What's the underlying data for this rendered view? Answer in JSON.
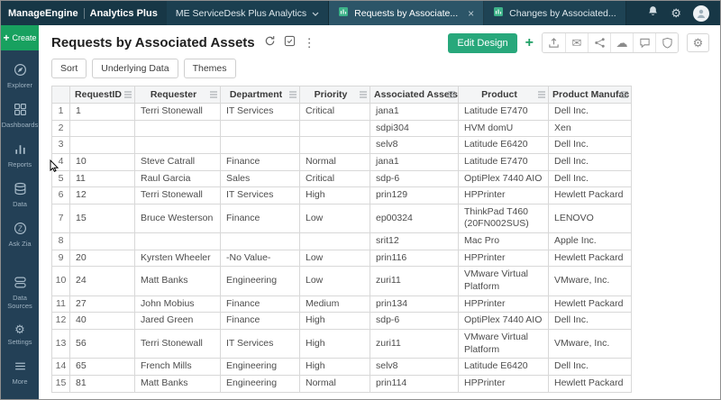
{
  "topbar": {
    "brand_primary": "ManageEngine",
    "brand_secondary": "Analytics Plus",
    "workspace_tab": "ME ServiceDesk Plus Analytics",
    "tabs": [
      {
        "label": "Requests by Associate...",
        "active": true
      },
      {
        "label": "Changes by Associated...",
        "active": false
      }
    ]
  },
  "glyphs": {
    "plus": "+",
    "close": "×",
    "kebab": "⋮",
    "gear": "⚙",
    "cloud": "☁",
    "mail": "✉"
  },
  "sidebar": {
    "create_label": "Create",
    "items": [
      {
        "label": "Explorer"
      },
      {
        "label": "Dashboards"
      },
      {
        "label": "Reports"
      },
      {
        "label": "Data"
      },
      {
        "label": "Ask Zia"
      },
      {
        "label": "Data Sources"
      },
      {
        "label": "Settings"
      },
      {
        "label": "More"
      }
    ]
  },
  "header": {
    "title": "Requests by Associated Assets",
    "edit_design_label": "Edit Design"
  },
  "toolbar": {
    "sort_label": "Sort",
    "underlying_data_label": "Underlying Data",
    "themes_label": "Themes"
  },
  "table": {
    "columns": [
      "RequestID",
      "Requester",
      "Department",
      "Priority",
      "Associated Assets",
      "Product",
      "Product Manufac"
    ],
    "rows": [
      {
        "num": "1",
        "cells": [
          "1",
          "Terri Stonewall",
          "IT Services",
          "Critical",
          "jana1",
          "Latitude E7470",
          "Dell Inc."
        ]
      },
      {
        "num": "2",
        "cells": [
          "",
          "",
          "",
          "",
          "sdpi304",
          "HVM domU",
          "Xen"
        ]
      },
      {
        "num": "3",
        "cells": [
          "",
          "",
          "",
          "",
          "selv8",
          "Latitude E6420",
          "Dell Inc."
        ]
      },
      {
        "num": "4",
        "cells": [
          "10",
          "Steve Catrall",
          "Finance",
          "Normal",
          "jana1",
          "Latitude E7470",
          "Dell Inc."
        ]
      },
      {
        "num": "5",
        "cells": [
          "11",
          "Raul Garcia",
          "Sales",
          "Critical",
          "sdp-6",
          "OptiPlex 7440 AIO",
          "Dell Inc."
        ]
      },
      {
        "num": "6",
        "cells": [
          "12",
          "Terri Stonewall",
          "IT Services",
          "High",
          "prin129",
          "HPPrinter",
          "Hewlett Packard"
        ]
      },
      {
        "num": "7",
        "cells": [
          "15",
          "Bruce Westerson",
          "Finance",
          "Low",
          "ep00324",
          "ThinkPad T460 (20FN002SUS)",
          "LENOVO"
        ]
      },
      {
        "num": "8",
        "cells": [
          "",
          "",
          "",
          "",
          "srit12",
          "Mac Pro",
          "Apple Inc."
        ]
      },
      {
        "num": "9",
        "cells": [
          "20",
          "Kyrsten Wheeler",
          "-No Value-",
          "Low",
          "prin116",
          "HPPrinter",
          "Hewlett Packard"
        ]
      },
      {
        "num": "10",
        "cells": [
          "24",
          "Matt Banks",
          "Engineering",
          "Low",
          "zuri11",
          "VMware Virtual Platform",
          "VMware, Inc."
        ]
      },
      {
        "num": "11",
        "cells": [
          "27",
          "John Mobius",
          "Finance",
          "Medium",
          "prin134",
          "HPPrinter",
          "Hewlett Packard"
        ]
      },
      {
        "num": "12",
        "cells": [
          "40",
          "Jared Green",
          "Finance",
          "High",
          "sdp-6",
          "OptiPlex 7440 AIO",
          "Dell Inc."
        ]
      },
      {
        "num": "13",
        "cells": [
          "56",
          "Terri Stonewall",
          "IT Services",
          "High",
          "zuri11",
          "VMware Virtual Platform",
          "VMware, Inc."
        ]
      },
      {
        "num": "14",
        "cells": [
          "65",
          "French Mills",
          "Engineering",
          "High",
          "selv8",
          "Latitude E6420",
          "Dell Inc."
        ]
      },
      {
        "num": "15",
        "cells": [
          "81",
          "Matt Banks",
          "Engineering",
          "Normal",
          "prin114",
          "HPPrinter",
          "Hewlett Packard"
        ]
      }
    ]
  },
  "colors": {
    "topbar_bg": "#173746",
    "sidebar_bg": "#234056",
    "create_green": "#18a15f",
    "edit_design_green": "#28a87b"
  }
}
